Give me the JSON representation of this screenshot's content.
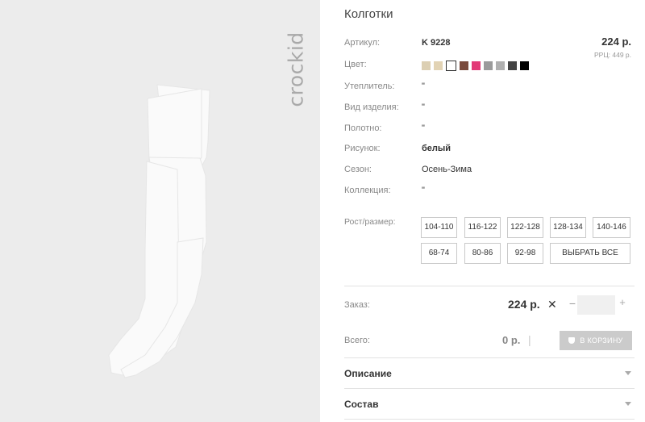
{
  "brand": "crockid",
  "product": {
    "title": "Колготки",
    "price": "224 р.",
    "rrp": "РРЦ: 449 р."
  },
  "attributes": [
    {
      "label": "Артикул:",
      "value": "K 9228"
    },
    {
      "label": "Цвет:",
      "value": ""
    },
    {
      "label": "Утеплитель:",
      "value": "\""
    },
    {
      "label": "Вид изделия:",
      "value": "\""
    },
    {
      "label": "Полотно:",
      "value": "\""
    },
    {
      "label": "Рисунок:",
      "value": "белый"
    },
    {
      "label": "Сезон:",
      "value": "Осень-Зима"
    },
    {
      "label": "Коллекция:",
      "value": "\""
    }
  ],
  "colors": [
    "#dccfb3",
    "#e2d3b4",
    "#ffffff",
    "#7a4a3c",
    "#e23a77",
    "#9b9b9b",
    "#b0b0b0",
    "#444444",
    "#000000"
  ],
  "sizes": {
    "label": "Рост/размер:",
    "options": [
      "104-110",
      "116-122",
      "122-128",
      "128-134",
      "140-146",
      "68-74",
      "80-86",
      "92-98"
    ],
    "select_all": "ВЫБРАТЬ ВСЕ"
  },
  "order": {
    "label": "Заказ:",
    "price": "224 р.",
    "times": "✕",
    "minus": "−",
    "plus": "+",
    "quantity": ""
  },
  "total": {
    "label": "Всего:",
    "value": "0 р.",
    "cart_button": "В КОРЗИНУ"
  },
  "accordion": [
    {
      "title": "Описание"
    },
    {
      "title": "Состав"
    }
  ]
}
